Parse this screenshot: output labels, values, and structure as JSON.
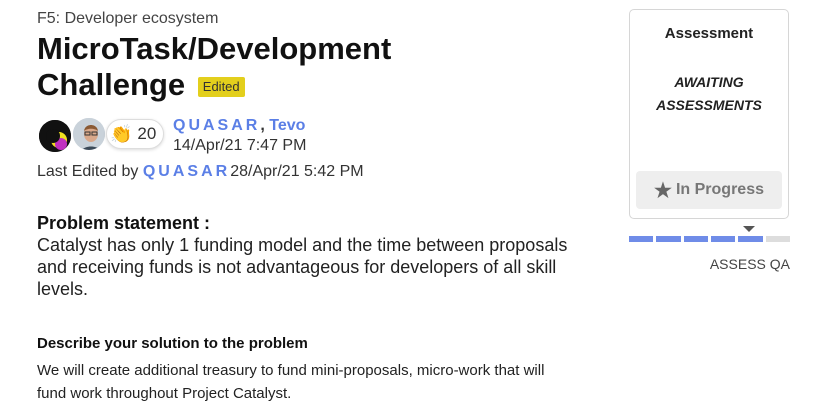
{
  "header": {
    "category": "F5: Developer ecosystem",
    "title": "MicroTask/Development Challenge",
    "edited_badge": "Edited"
  },
  "authors": {
    "clap_count": "20",
    "names": [
      "QUASAR",
      "Tevo"
    ],
    "separator": ", ",
    "posted": "14/Apr/21 7:47 PM"
  },
  "last_edited": {
    "label": "Last Edited by",
    "user": "QUASAR",
    "date": "28/Apr/21 5:42 PM"
  },
  "problem": {
    "label": "Problem statement :",
    "text": "Catalyst has only 1 funding model and the time between proposals and receiving funds is not advantageous for developers of all skill levels."
  },
  "solution": {
    "label": "Describe your solution to the problem",
    "text": "We will create additional treasury to fund mini-proposals, micro-work that will fund work throughout Project Catalyst."
  },
  "assessment": {
    "title": "Assessment",
    "status": "AWAITING ASSESSMENTS",
    "button_label": "In Progress",
    "stage_label": "ASSESS QA",
    "stages_total": 6,
    "stages_done": 5,
    "colors": {
      "active": "#6f8ce8",
      "inactive": "#dddddd",
      "badge": "#e3cf1c",
      "link": "#5b7fe6"
    }
  }
}
